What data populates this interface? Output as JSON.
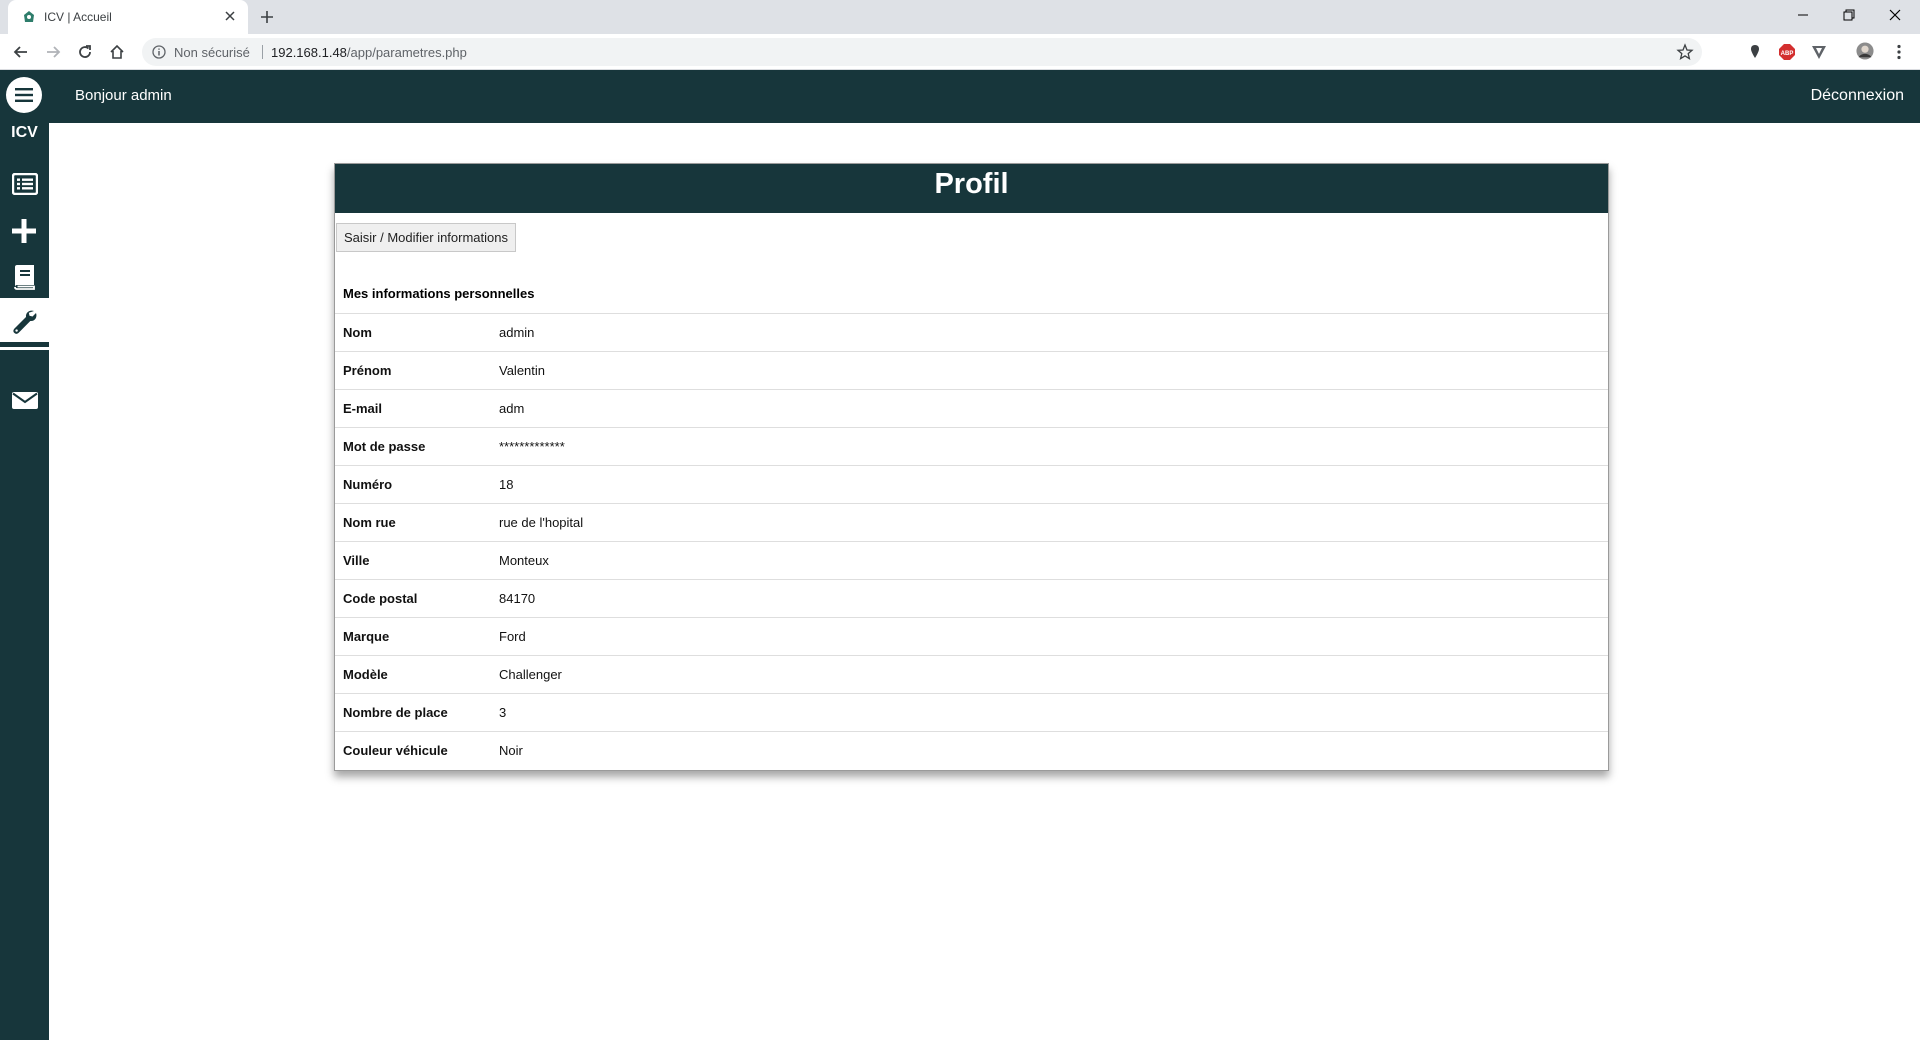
{
  "browser": {
    "tab_title": "ICV | Accueil",
    "security_label": "Non sécurisé",
    "url_host": "192.168.1.48",
    "url_path": "/app/parametres.php"
  },
  "app": {
    "brand": "ICV",
    "greeting": "Bonjour admin",
    "logout_label": "Déconnexion",
    "sidebar_icons": [
      "menu-icon",
      "list-icon",
      "plus-icon",
      "book-icon",
      "wrench-icon",
      "envelope-icon"
    ],
    "accent_color": "#17363b"
  },
  "profile": {
    "title": "Profil",
    "edit_button": "Saisir / Modifier informations",
    "section_title": "Mes informations personnelles",
    "rows": [
      {
        "label": "Nom",
        "value": "admin"
      },
      {
        "label": "Prénom",
        "value": "Valentin"
      },
      {
        "label": "E-mail",
        "value": "adm"
      },
      {
        "label": "Mot de passe",
        "value": "*************"
      },
      {
        "label": "Numéro",
        "value": "18"
      },
      {
        "label": "Nom rue",
        "value": "rue de l'hopital"
      },
      {
        "label": "Ville",
        "value": "Monteux"
      },
      {
        "label": "Code postal",
        "value": "84170"
      },
      {
        "label": "Marque",
        "value": "Ford"
      },
      {
        "label": "Modèle",
        "value": "Challenger"
      },
      {
        "label": "Nombre de place",
        "value": "3"
      },
      {
        "label": "Couleur véhicule",
        "value": "Noir"
      }
    ]
  }
}
